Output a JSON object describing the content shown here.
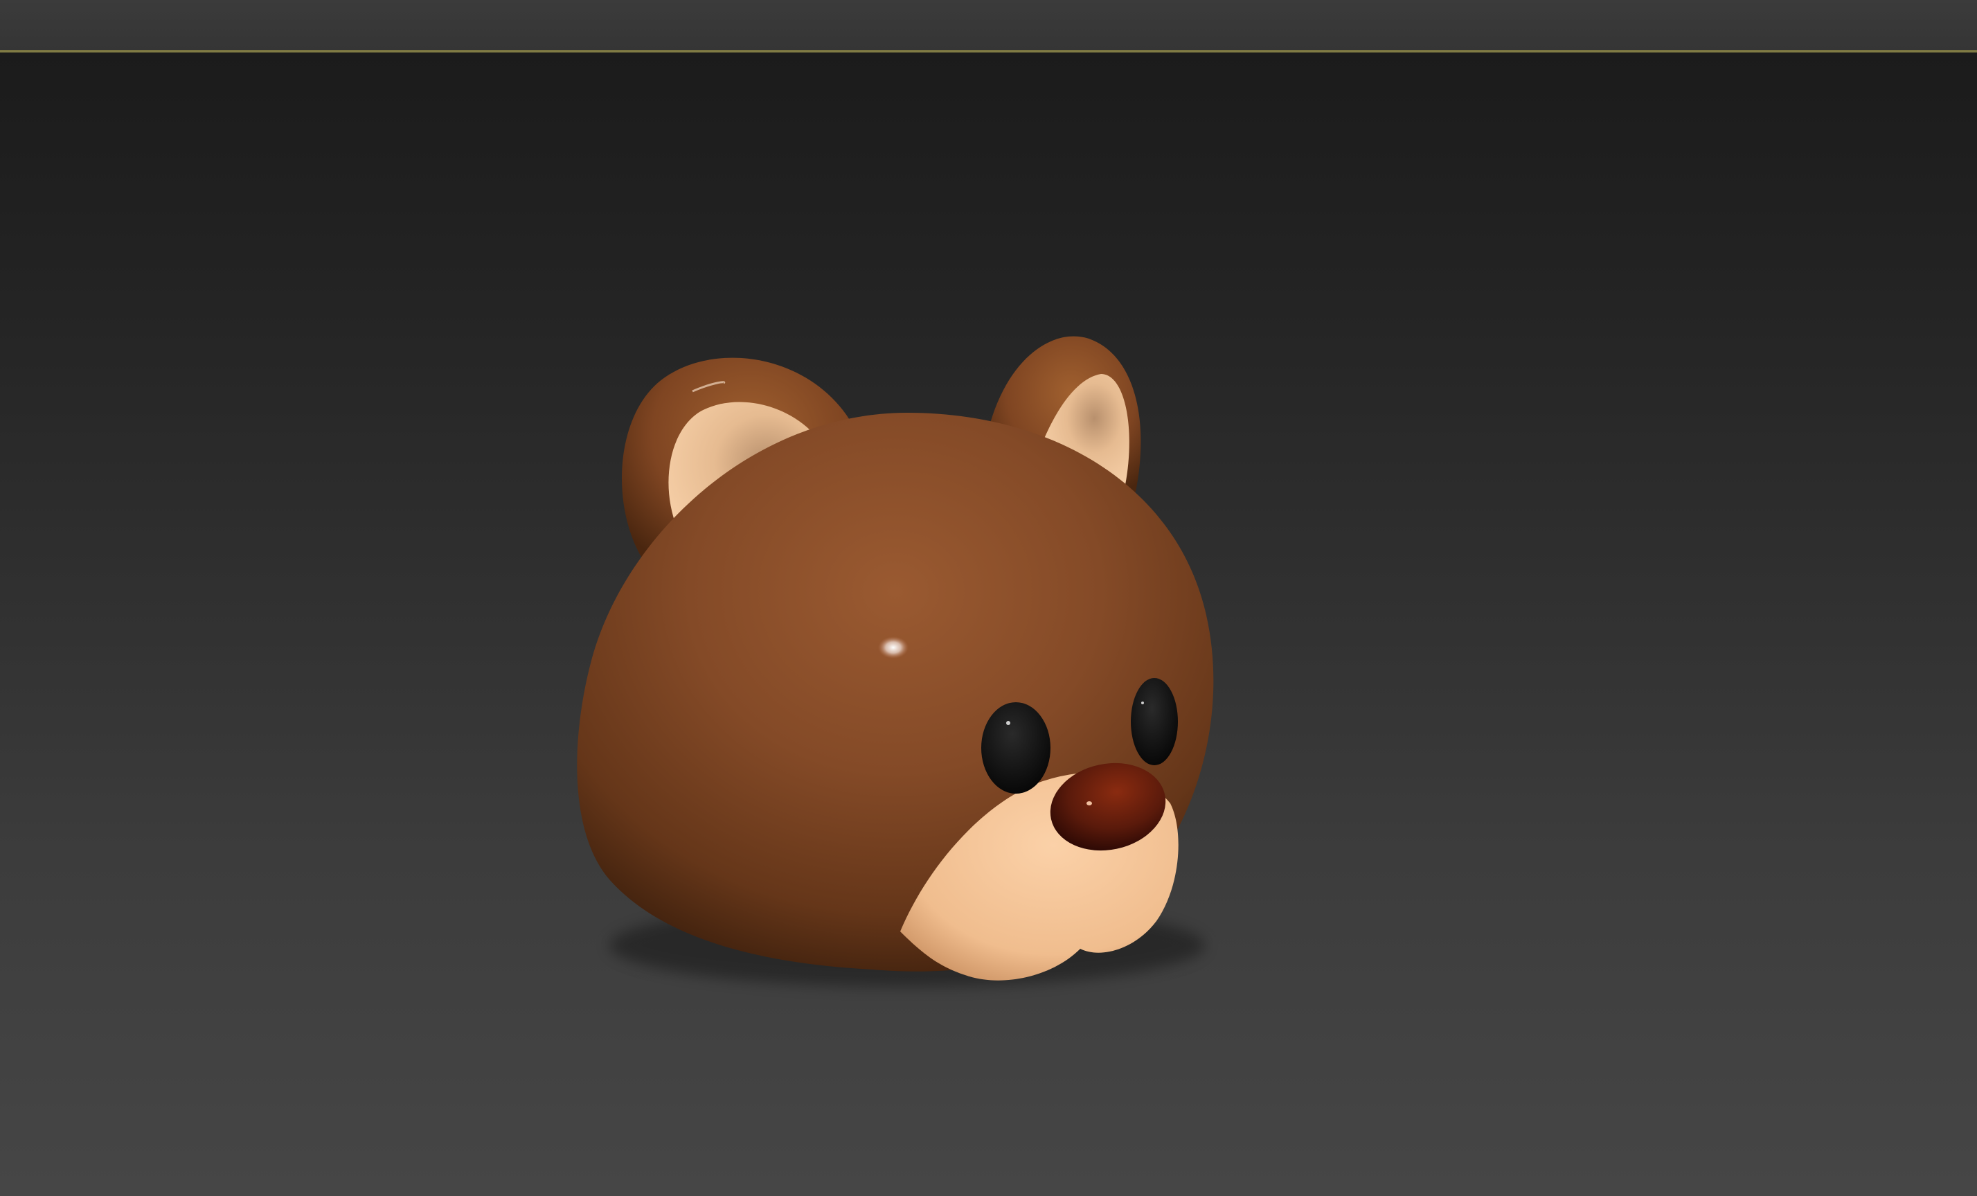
{
  "app": {
    "title": "",
    "accent_color": "#8d874c"
  },
  "viewport": {
    "background_top": "#1b1b1b",
    "background_bottom": "#464646",
    "label": ""
  },
  "scene": {
    "object": "bear-head",
    "colors": {
      "fur": "#8a4e2a",
      "fur_dark": "#4e2a14",
      "inner_ear": "#f0c79c",
      "muzzle": "#f5c69a",
      "nose": "#5a1a0b",
      "eyes": "#0b0b0b"
    }
  }
}
